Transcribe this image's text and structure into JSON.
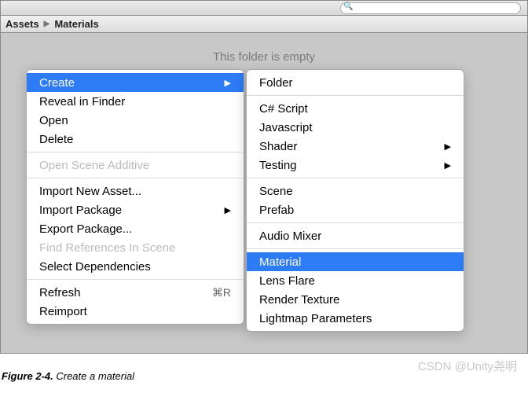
{
  "search": {
    "placeholder": ""
  },
  "breadcrumb": {
    "root": "Assets",
    "current": "Materials"
  },
  "empty_message": "This folder is empty",
  "menu1": {
    "items": [
      {
        "label": "Create",
        "selected": true,
        "submenu": true
      },
      {
        "label": "Reveal in Finder"
      },
      {
        "label": "Open"
      },
      {
        "label": "Delete"
      },
      {
        "sep": true
      },
      {
        "label": "Open Scene Additive",
        "disabled": true
      },
      {
        "sep": true
      },
      {
        "label": "Import New Asset..."
      },
      {
        "label": "Import Package",
        "submenu": true
      },
      {
        "label": "Export Package..."
      },
      {
        "label": "Find References In Scene",
        "disabled": true
      },
      {
        "label": "Select Dependencies"
      },
      {
        "sep": true
      },
      {
        "label": "Refresh",
        "shortcut": "⌘R"
      },
      {
        "label": "Reimport"
      }
    ]
  },
  "menu2": {
    "items": [
      {
        "label": "Folder"
      },
      {
        "sep": true
      },
      {
        "label": "C# Script"
      },
      {
        "label": "Javascript"
      },
      {
        "label": "Shader",
        "submenu": true
      },
      {
        "label": "Testing",
        "submenu": true
      },
      {
        "sep": true
      },
      {
        "label": "Scene"
      },
      {
        "label": "Prefab"
      },
      {
        "sep": true
      },
      {
        "label": "Audio Mixer"
      },
      {
        "sep": true
      },
      {
        "label": "Material",
        "selected": true
      },
      {
        "label": "Lens Flare"
      },
      {
        "label": "Render Texture"
      },
      {
        "label": "Lightmap Parameters"
      }
    ]
  },
  "caption": {
    "figure": "Figure 2-4.",
    "text": " Create a material"
  },
  "watermark": "CSDN @Unity尧明"
}
